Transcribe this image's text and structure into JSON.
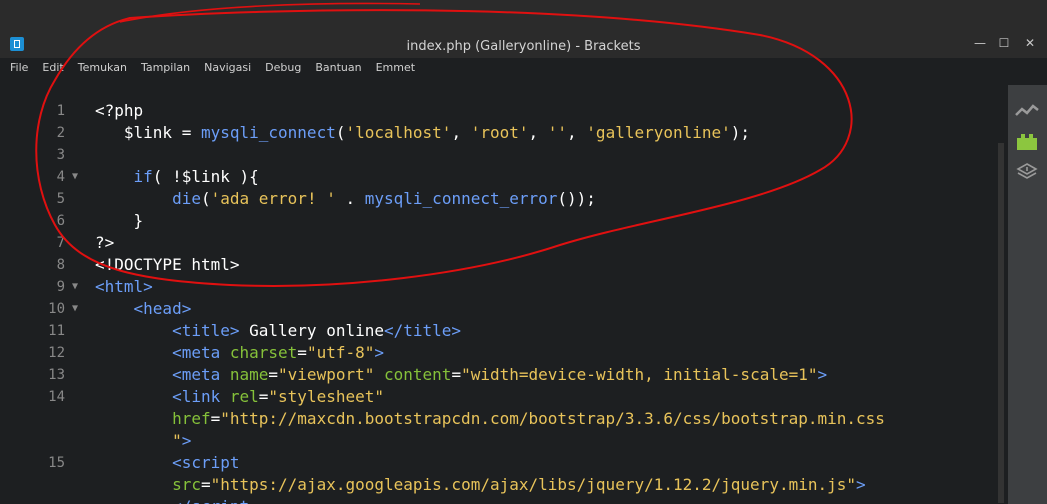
{
  "window": {
    "title": "index.php (Galleryonline) - Brackets",
    "minimize_glyph": "—",
    "maximize_glyph": "☐",
    "close_glyph": "✕"
  },
  "menu": [
    "File",
    "Edit",
    "Temukan",
    "Tampilan",
    "Navigasi",
    "Debug",
    "Bantuan",
    "Emmet"
  ],
  "icons": {
    "app": "brackets-logo-icon",
    "live_preview": "live-preview-icon",
    "extension_manager": "extension-manager-icon",
    "layers": "layers-icon"
  },
  "colors": {
    "annotation": "#e01010",
    "keyword": "#6c9ef8",
    "string": "#e8c35a",
    "attribute": "#85c13a"
  },
  "code_lines": [
    {
      "n": "1",
      "fold": false,
      "tokens": [
        [
          "plain",
          "<?php"
        ]
      ]
    },
    {
      "n": "2",
      "fold": false,
      "tokens": [
        [
          "plain",
          "   $link = "
        ],
        [
          "fn",
          "mysqli_connect"
        ],
        [
          "plain",
          "("
        ],
        [
          "str",
          "'localhost'"
        ],
        [
          "plain",
          ", "
        ],
        [
          "str",
          "'root'"
        ],
        [
          "plain",
          ", "
        ],
        [
          "str",
          "''"
        ],
        [
          "plain",
          ", "
        ],
        [
          "str",
          "'galleryonline'"
        ],
        [
          "plain",
          ");"
        ]
      ]
    },
    {
      "n": "3",
      "fold": false,
      "tokens": [
        [
          "plain",
          ""
        ]
      ]
    },
    {
      "n": "4",
      "fold": true,
      "tokens": [
        [
          "plain",
          "    "
        ],
        [
          "kw",
          "if"
        ],
        [
          "plain",
          "( !$link ){"
        ]
      ]
    },
    {
      "n": "5",
      "fold": false,
      "tokens": [
        [
          "plain",
          "        "
        ],
        [
          "fn",
          "die"
        ],
        [
          "plain",
          "("
        ],
        [
          "str",
          "'ada error! '"
        ],
        [
          "plain",
          " . "
        ],
        [
          "fn",
          "mysqli_connect_error"
        ],
        [
          "plain",
          "());"
        ]
      ]
    },
    {
      "n": "6",
      "fold": false,
      "tokens": [
        [
          "plain",
          "    }"
        ]
      ]
    },
    {
      "n": "7",
      "fold": false,
      "tokens": [
        [
          "plain",
          "?>"
        ]
      ]
    },
    {
      "n": "8",
      "fold": false,
      "tokens": [
        [
          "plain",
          "<!DOCTYPE html>"
        ]
      ]
    },
    {
      "n": "9",
      "fold": true,
      "tokens": [
        [
          "tag",
          "<html>"
        ]
      ]
    },
    {
      "n": "10",
      "fold": true,
      "tokens": [
        [
          "plain",
          "    "
        ],
        [
          "tag",
          "<head>"
        ]
      ]
    },
    {
      "n": "11",
      "fold": false,
      "tokens": [
        [
          "plain",
          "        "
        ],
        [
          "tag",
          "<title>"
        ],
        [
          "plain",
          " Gallery online"
        ],
        [
          "tag",
          "</title>"
        ]
      ]
    },
    {
      "n": "12",
      "fold": false,
      "tokens": [
        [
          "plain",
          "        "
        ],
        [
          "tag",
          "<meta "
        ],
        [
          "attr",
          "charset"
        ],
        [
          "plain",
          "="
        ],
        [
          "str",
          "\"utf-8\""
        ],
        [
          "tag",
          ">"
        ]
      ]
    },
    {
      "n": "13",
      "fold": false,
      "tokens": [
        [
          "plain",
          "        "
        ],
        [
          "tag",
          "<meta "
        ],
        [
          "attr",
          "name"
        ],
        [
          "plain",
          "="
        ],
        [
          "str",
          "\"viewport\""
        ],
        [
          "plain",
          " "
        ],
        [
          "attr",
          "content"
        ],
        [
          "plain",
          "="
        ],
        [
          "str",
          "\"width=device-width, initial-scale=1\""
        ],
        [
          "tag",
          ">"
        ]
      ]
    },
    {
      "n": "14",
      "fold": false,
      "tokens": [
        [
          "plain",
          "        "
        ],
        [
          "tag",
          "<link "
        ],
        [
          "attr",
          "rel"
        ],
        [
          "plain",
          "="
        ],
        [
          "str",
          "\"stylesheet\""
        ]
      ]
    },
    {
      "n": "",
      "fold": false,
      "tokens": [
        [
          "plain",
          "        "
        ],
        [
          "attr",
          "href"
        ],
        [
          "plain",
          "="
        ],
        [
          "str",
          "\"http://maxcdn.bootstrapcdn.com/bootstrap/3.3.6/css/bootstrap.min.css"
        ]
      ]
    },
    {
      "n": "",
      "fold": false,
      "tokens": [
        [
          "plain",
          "        "
        ],
        [
          "str",
          "\""
        ],
        [
          "tag",
          ">"
        ]
      ]
    },
    {
      "n": "15",
      "fold": false,
      "tokens": [
        [
          "plain",
          "        "
        ],
        [
          "tag",
          "<script"
        ]
      ]
    },
    {
      "n": "",
      "fold": false,
      "tokens": [
        [
          "plain",
          "        "
        ],
        [
          "attr",
          "src"
        ],
        [
          "plain",
          "="
        ],
        [
          "str",
          "\"https://ajax.googleapis.com/ajax/libs/jquery/1.12.2/jquery.min.js\""
        ],
        [
          "tag",
          ">"
        ]
      ]
    },
    {
      "n": "",
      "fold": false,
      "tokens": [
        [
          "plain",
          "        "
        ],
        [
          "tag",
          "</script"
        ]
      ]
    }
  ]
}
